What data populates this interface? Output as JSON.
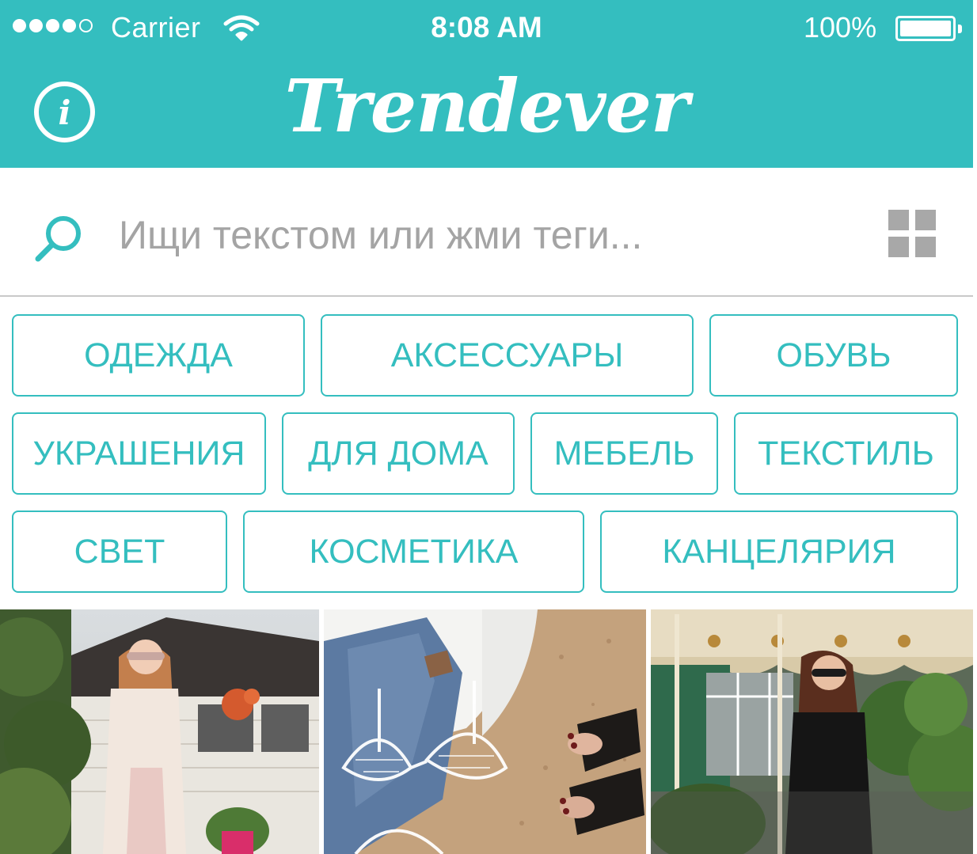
{
  "status_bar": {
    "carrier": "Carrier",
    "time": "8:08 AM",
    "battery_percent": "100%",
    "signal_bars": 4,
    "signal_max": 5
  },
  "header": {
    "logo": "Trendever",
    "info_icon": "info-icon",
    "info_glyph": "i"
  },
  "search": {
    "placeholder": "Ищи текстом или жми теги...",
    "value": "",
    "search_icon": "search-icon",
    "view_toggle_icon": "grid-icon"
  },
  "tags": [
    "ОДЕЖДА",
    "АКСЕССУАРЫ",
    "ОБУВЬ",
    "УКРАШЕНИЯ",
    "ДЛЯ ДОМА",
    "МЕБЕЛЬ",
    "ТЕКСТИЛЬ",
    "СВЕТ",
    "КОСМЕТИКА",
    "КАНЦЕЛЯРИЯ"
  ],
  "feed": {
    "photos": [
      "photo-woman-street",
      "photo-beach-flatlay",
      "photo-woman-terrace"
    ]
  },
  "colors": {
    "accent": "#34bebf",
    "placeholder": "#a4a4a4",
    "icon_gray": "#a8a8a8",
    "divider": "#c9c9c9"
  }
}
